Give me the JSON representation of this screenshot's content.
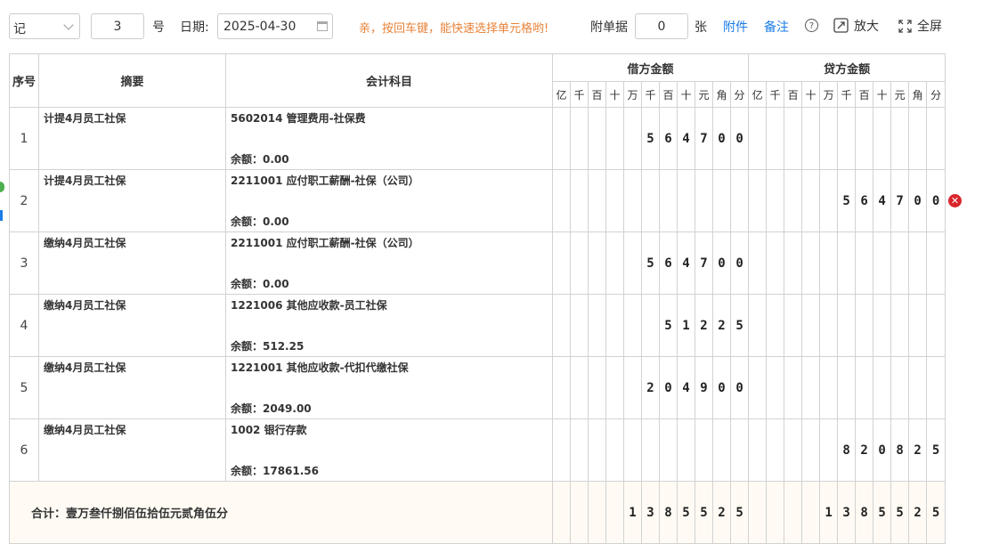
{
  "toolbar": {
    "voucher_type": "记",
    "voucher_no": "3",
    "no_suffix": "号",
    "date_label": "日期:",
    "date_value": "2025-04-30",
    "hint": "亲，按回车键，能快速选择单元格哟!",
    "attach_label": "附单据",
    "attach_count": "0",
    "attach_unit": "张",
    "attachment_link": "附件",
    "note_link": "备注",
    "help_icon": "question-circle-icon",
    "zoom_label": "放大",
    "fullscreen_label": "全屏"
  },
  "headers": {
    "seq": "序号",
    "summary": "摘要",
    "account": "会计科目",
    "debit": "借方金额",
    "credit": "贷方金额",
    "digits": [
      "亿",
      "千",
      "百",
      "十",
      "万",
      "千",
      "百",
      "十",
      "元",
      "角",
      "分"
    ]
  },
  "rows": [
    {
      "seq": "1",
      "summary": "计提4月员工社保",
      "account": "5602014 管理费用-社保费",
      "balance": "余额：0.00",
      "debit": [
        "",
        "",
        "",
        "",
        "",
        "5",
        "6",
        "4",
        "7",
        "0",
        "0"
      ],
      "credit": [
        "",
        "",
        "",
        "",
        "",
        "",
        "",
        "",
        "",
        "",
        ""
      ]
    },
    {
      "seq": "2",
      "summary": "计提4月员工社保",
      "account": "2211001 应付职工薪酬-社保（公司）",
      "balance": "余额：0.00",
      "debit": [
        "",
        "",
        "",
        "",
        "",
        "",
        "",
        "",
        "",
        "",
        ""
      ],
      "credit": [
        "",
        "",
        "",
        "",
        "",
        "5",
        "6",
        "4",
        "7",
        "0",
        "0"
      ]
    },
    {
      "seq": "3",
      "summary": "缴纳4月员工社保",
      "account": "2211001 应付职工薪酬-社保（公司）",
      "balance": "余额：0.00",
      "debit": [
        "",
        "",
        "",
        "",
        "",
        "5",
        "6",
        "4",
        "7",
        "0",
        "0"
      ],
      "credit": [
        "",
        "",
        "",
        "",
        "",
        "",
        "",
        "",
        "",
        "",
        ""
      ]
    },
    {
      "seq": "4",
      "summary": "缴纳4月员工社保",
      "account": "1221006 其他应收款-员工社保",
      "balance": "余额：512.25",
      "debit": [
        "",
        "",
        "",
        "",
        "",
        "",
        "5",
        "1",
        "2",
        "2",
        "5"
      ],
      "credit": [
        "",
        "",
        "",
        "",
        "",
        "",
        "",
        "",
        "",
        "",
        ""
      ]
    },
    {
      "seq": "5",
      "summary": "缴纳4月员工社保",
      "account": "1221001 其他应收款-代扣代缴社保",
      "balance": "余额：2049.00",
      "debit": [
        "",
        "",
        "",
        "",
        "",
        "2",
        "0",
        "4",
        "9",
        "0",
        "0"
      ],
      "credit": [
        "",
        "",
        "",
        "",
        "",
        "",
        "",
        "",
        "",
        "",
        ""
      ]
    },
    {
      "seq": "6",
      "summary": "缴纳4月员工社保",
      "account": "1002 银行存款",
      "balance": "余额：17861.56",
      "debit": [
        "",
        "",
        "",
        "",
        "",
        "",
        "",
        "",
        "",
        "",
        ""
      ],
      "credit": [
        "",
        "",
        "",
        "",
        "",
        "8",
        "2",
        "0",
        "8",
        "2",
        "5"
      ]
    }
  ],
  "total": {
    "label": "合计：壹万叁仟捌佰伍拾伍元贰角伍分",
    "debit": [
      "",
      "",
      "",
      "",
      "1",
      "3",
      "8",
      "5",
      "5",
      "2",
      "5"
    ],
    "credit": [
      "",
      "",
      "",
      "",
      "1",
      "3",
      "8",
      "5",
      "5",
      "2",
      "5"
    ]
  },
  "delete_icon": "close-circle-icon"
}
